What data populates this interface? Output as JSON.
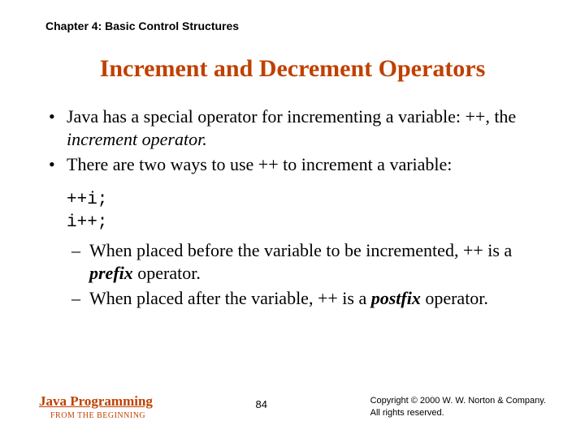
{
  "chapter": "Chapter 4: Basic Control Structures",
  "title": "Increment and Decrement Operators",
  "bullets": {
    "b1_pre": "Java has a special operator for incrementing a variable: ++, the ",
    "b1_em": "increment operator.",
    "b2": "There are two ways to use ++ to increment a variable:"
  },
  "code": {
    "line1": "++i;",
    "line2": "i++;"
  },
  "sub": {
    "s1_pre": "When placed before the variable to be incremented, ++ is a ",
    "s1_em": "prefix",
    "s1_post": " operator.",
    "s2_pre": "When placed after the variable, ++ is a ",
    "s2_em": "postfix",
    "s2_post": " operator."
  },
  "footer": {
    "book_line1": "Java Programming",
    "book_line2": "FROM THE BEGINNING",
    "page": "84",
    "copy_line1": "Copyright © 2000 W. W. Norton & Company.",
    "copy_line2": "All rights reserved."
  }
}
